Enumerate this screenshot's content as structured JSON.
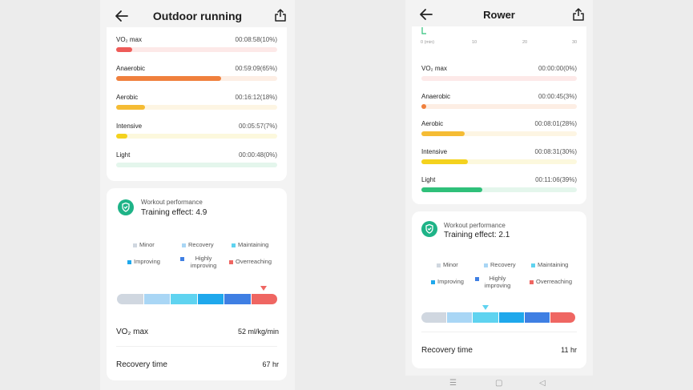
{
  "screen1": {
    "title": "Outdoor running",
    "zones": [
      {
        "name": "VO₂ max",
        "time": "00:08:58(10%)",
        "fraction": 0.1,
        "color": "#ee5b58",
        "track": "#fde9e8"
      },
      {
        "name": "Anaerobic",
        "time": "00:59:09(65%)",
        "fraction": 0.65,
        "color": "#f0803d",
        "track": "#fdeee4"
      },
      {
        "name": "Aerobic",
        "time": "00:16:12(18%)",
        "fraction": 0.18,
        "color": "#f5bc34",
        "track": "#fdf5e3"
      },
      {
        "name": "Intensive",
        "time": "00:05:57(7%)",
        "fraction": 0.07,
        "color": "#f4d21e",
        "track": "#fcf8dd"
      },
      {
        "name": "Light",
        "time": "00:00:48(0%)",
        "fraction": 0.0,
        "color": "#2fc07a",
        "track": "#e4f6ec"
      }
    ],
    "workout": {
      "label": "Workout performance",
      "value": "Training effect: 4.9",
      "marker_index": 5
    },
    "metrics": [
      {
        "label": "VO₂ max",
        "value": "52 ml/kg/min"
      },
      {
        "label": "Recovery time",
        "value": "67 hr"
      }
    ]
  },
  "screen2": {
    "title": "Rower",
    "axis_ticks": [
      "0 (min)",
      "10",
      "20",
      "30"
    ],
    "zones": [
      {
        "name": "VO₂ max",
        "time": "00:00:00(0%)",
        "fraction": 0.0,
        "color": "#ee5b58",
        "track": "#fde9e8"
      },
      {
        "name": "Anaerobic",
        "time": "00:00:45(3%)",
        "fraction": 0.03,
        "color": "#f0803d",
        "track": "#fdeee4"
      },
      {
        "name": "Aerobic",
        "time": "00:08:01(28%)",
        "fraction": 0.28,
        "color": "#f5bc34",
        "track": "#fdf5e3"
      },
      {
        "name": "Intensive",
        "time": "00:08:31(30%)",
        "fraction": 0.3,
        "color": "#f4d21e",
        "track": "#fcf8dd"
      },
      {
        "name": "Light",
        "time": "00:11:06(39%)",
        "fraction": 0.39,
        "color": "#2fc07a",
        "track": "#e4f6ec"
      }
    ],
    "workout": {
      "label": "Workout performance",
      "value": "Training effect: 2.1",
      "marker_index": 2
    },
    "metrics": [
      {
        "label": "Recovery time",
        "value": "11 hr"
      }
    ]
  },
  "legend": [
    {
      "label": "Minor",
      "color": "#d0d7e0"
    },
    {
      "label": "Recovery",
      "color": "#a9d6f5"
    },
    {
      "label": "Maintaining",
      "color": "#5fd3f0"
    },
    {
      "label": "Improving",
      "color": "#1fa8ec"
    },
    {
      "label": "Highly improving",
      "color": "#3f7fe3"
    },
    {
      "label": "Overreaching",
      "color": "#ef6662"
    }
  ],
  "colors": {
    "badge": "#1eb387",
    "marker_high": "#ef6662",
    "marker_low": "#5fd3f0"
  },
  "icons": [
    "back-arrow-icon",
    "share-icon",
    "shield-check-icon",
    "menu-nav-icon",
    "home-nav-icon",
    "back-nav-icon"
  ],
  "nav_glyphs": {
    "menu": "☰",
    "home": "▢",
    "back": "◁"
  }
}
